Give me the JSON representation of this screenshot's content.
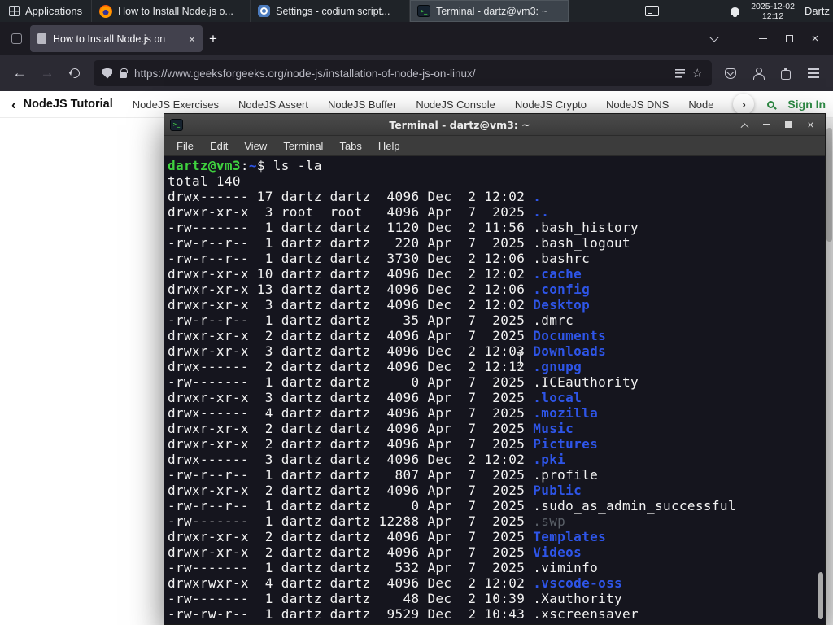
{
  "panel": {
    "applications_label": "Applications",
    "windows": [
      {
        "label": "How to Install Node.js o...",
        "icon": "firefox-icon"
      },
      {
        "label": "Settings - codium script...",
        "icon": "settings-icon"
      },
      {
        "label": "Terminal - dartz@vm3: ~",
        "icon": "terminal-icon"
      }
    ],
    "clock_date": "2025-12-02",
    "clock_time": "12:12",
    "user_label": "Dartz"
  },
  "browser": {
    "tab_title": "How to Install Node.js on",
    "url": "https://www.geeksforgeeks.org/node-js/installation-of-node-js-on-linux/",
    "site_nav": {
      "back_label": "NodeJS Tutorial",
      "links": [
        "NodeJS Exercises",
        "NodeJS Assert",
        "NodeJS Buffer",
        "NodeJS Console",
        "NodeJS Crypto",
        "NodeJS DNS",
        "Node"
      ],
      "sign_in_label": "Sign In"
    }
  },
  "terminal": {
    "title": "Terminal - dartz@vm3: ~",
    "menus": [
      "File",
      "Edit",
      "View",
      "Terminal",
      "Tabs",
      "Help"
    ],
    "lines": [
      [
        [
          "dartz@vm3",
          "g"
        ],
        [
          ":",
          "w"
        ],
        [
          "~",
          "b"
        ],
        [
          "$ ls -la",
          "w"
        ]
      ],
      [
        [
          "total 140",
          "w"
        ]
      ],
      [
        [
          "drwx------ 17 dartz dartz  4096 Dec  2 12:02 ",
          "w"
        ],
        [
          ".",
          "b"
        ]
      ],
      [
        [
          "drwxr-xr-x  3 root  root   4096 Apr  7  2025 ",
          "w"
        ],
        [
          "..",
          "b"
        ]
      ],
      [
        [
          "-rw-------  1 dartz dartz  1120 Dec  2 11:56 ",
          "w"
        ],
        [
          ".bash_history",
          "w"
        ]
      ],
      [
        [
          "-rw-r--r--  1 dartz dartz   220 Apr  7  2025 ",
          "w"
        ],
        [
          ".bash_logout",
          "w"
        ]
      ],
      [
        [
          "-rw-r--r--  1 dartz dartz  3730 Dec  2 12:06 ",
          "w"
        ],
        [
          ".bashrc",
          "w"
        ]
      ],
      [
        [
          "drwxr-xr-x 10 dartz dartz  4096 Dec  2 12:02 ",
          "w"
        ],
        [
          ".cache",
          "b"
        ]
      ],
      [
        [
          "drwxr-xr-x 13 dartz dartz  4096 Dec  2 12:06 ",
          "w"
        ],
        [
          ".config",
          "b"
        ]
      ],
      [
        [
          "drwxr-xr-x  3 dartz dartz  4096 Dec  2 12:02 ",
          "w"
        ],
        [
          "Desktop",
          "b"
        ]
      ],
      [
        [
          "-rw-r--r--  1 dartz dartz    35 Apr  7  2025 ",
          "w"
        ],
        [
          ".dmrc",
          "w"
        ]
      ],
      [
        [
          "drwxr-xr-x  2 dartz dartz  4096 Apr  7  2025 ",
          "w"
        ],
        [
          "Documents",
          "b"
        ]
      ],
      [
        [
          "drwxr-xr-x  3 dartz dartz  4096 Dec  2 12:03 ",
          "w"
        ],
        [
          "Downloads",
          "b"
        ]
      ],
      [
        [
          "drwx------  2 dartz dartz  4096 Dec  2 12:12 ",
          "w"
        ],
        [
          ".gnupg",
          "b"
        ]
      ],
      [
        [
          "-rw-------  1 dartz dartz     0 Apr  7  2025 ",
          "w"
        ],
        [
          ".ICEauthority",
          "w"
        ]
      ],
      [
        [
          "drwxr-xr-x  3 dartz dartz  4096 Apr  7  2025 ",
          "w"
        ],
        [
          ".local",
          "b"
        ]
      ],
      [
        [
          "drwx------  4 dartz dartz  4096 Apr  7  2025 ",
          "w"
        ],
        [
          ".mozilla",
          "b"
        ]
      ],
      [
        [
          "drwxr-xr-x  2 dartz dartz  4096 Apr  7  2025 ",
          "w"
        ],
        [
          "Music",
          "b"
        ]
      ],
      [
        [
          "drwxr-xr-x  2 dartz dartz  4096 Apr  7  2025 ",
          "w"
        ],
        [
          "Pictures",
          "b"
        ]
      ],
      [
        [
          "drwx------  3 dartz dartz  4096 Dec  2 12:02 ",
          "w"
        ],
        [
          ".pki",
          "b"
        ]
      ],
      [
        [
          "-rw-r--r--  1 dartz dartz   807 Apr  7  2025 ",
          "w"
        ],
        [
          ".profile",
          "w"
        ]
      ],
      [
        [
          "drwxr-xr-x  2 dartz dartz  4096 Apr  7  2025 ",
          "w"
        ],
        [
          "Public",
          "b"
        ]
      ],
      [
        [
          "-rw-r--r--  1 dartz dartz     0 Apr  7  2025 ",
          "w"
        ],
        [
          ".sudo_as_admin_successful",
          "w"
        ]
      ],
      [
        [
          "-rw-------  1 dartz dartz 12288 Apr  7  2025 ",
          "w"
        ],
        [
          ".swp",
          "d"
        ]
      ],
      [
        [
          "drwxr-xr-x  2 dartz dartz  4096 Apr  7  2025 ",
          "w"
        ],
        [
          "Templates",
          "b"
        ]
      ],
      [
        [
          "drwxr-xr-x  2 dartz dartz  4096 Apr  7  2025 ",
          "w"
        ],
        [
          "Videos",
          "b"
        ]
      ],
      [
        [
          "-rw-------  1 dartz dartz   532 Apr  7  2025 ",
          "w"
        ],
        [
          ".viminfo",
          "w"
        ]
      ],
      [
        [
          "drwxrwxr-x  4 dartz dartz  4096 Dec  2 12:02 ",
          "w"
        ],
        [
          ".vscode-oss",
          "b"
        ]
      ],
      [
        [
          "-rw-------  1 dartz dartz    48 Dec  2 10:39 ",
          "w"
        ],
        [
          ".Xauthority",
          "w"
        ]
      ],
      [
        [
          "-rw-rw-r--  1 dartz dartz  9529 Dec  2 10:43 ",
          "w"
        ],
        [
          ".xscreensaver",
          "w"
        ]
      ]
    ]
  },
  "icons": {
    "close": "×",
    "new_tab": "+",
    "back": "←",
    "forward": "→",
    "star": "☆",
    "site_back_chevron": "‹",
    "site_forward_chevron": "›",
    "terminal_glyph": ">_"
  },
  "colors": {
    "gfg_green": "#2f8d46",
    "terminal_background": "#15151e",
    "terminal_foreground": "#f2f2f2",
    "terminal_prompt_green": "#3fd23f",
    "terminal_directory_blue": "#2e55e8",
    "terminal_dim_file": "#5a6068",
    "firefox_chrome": "#2b2a33",
    "firefox_tabbar": "#1c1b22",
    "panel_background": "#1f2328"
  }
}
